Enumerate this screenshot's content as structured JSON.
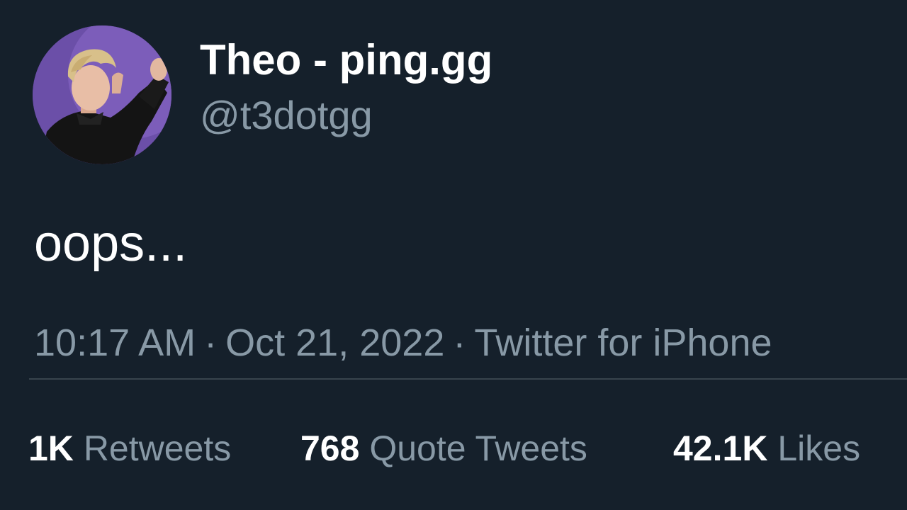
{
  "user": {
    "display_name": "Theo - ping.gg",
    "handle": "@t3dotgg",
    "avatar_icon": "profile-photo"
  },
  "tweet": {
    "text": "oops..."
  },
  "meta": {
    "time": "10:17 AM",
    "separator": "·",
    "date": "Oct 21, 2022",
    "source": "Twitter for iPhone"
  },
  "stats": {
    "retweets": {
      "count": "1K",
      "label": "Retweets"
    },
    "quote_tweets": {
      "count": "768",
      "label": "Quote Tweets"
    },
    "likes": {
      "count": "42.1K",
      "label": "Likes"
    }
  },
  "colors": {
    "background": "#15202b",
    "primary_text": "#ffffff",
    "secondary_text": "#8899a6",
    "divider": "#38444d"
  }
}
